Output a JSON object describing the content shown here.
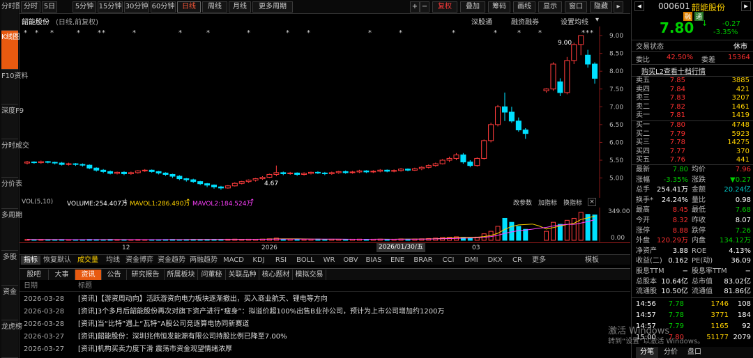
{
  "left_tabs": [
    "分时图",
    "K线图",
    "F10资料",
    "深度F9",
    "分时成交",
    "分价表",
    "多周期",
    "多股",
    "资金",
    "龙虎榜"
  ],
  "toolbar": {
    "left": [
      "分时",
      "5日",
      "5分钟",
      "15分钟",
      "30分钟",
      "60分钟",
      "日线",
      "周线",
      "月线",
      "更多周期"
    ],
    "right": [
      "+",
      "−",
      "复权",
      "叠加",
      "筹码",
      "画线",
      "显示",
      "窗口",
      "隐藏"
    ],
    "active": "日线"
  },
  "chart_header": {
    "stock": "韶能股份",
    "mode": "(日线,前复权)",
    "links": [
      "深股通",
      "融资融券",
      "设置均线"
    ]
  },
  "price_axis": [
    "9.00",
    "8.50",
    "8.00",
    "7.50",
    "7.00",
    "6.50",
    "6.00",
    "5.50",
    "5.00"
  ],
  "annotations": {
    "high": "9.00",
    "low": "4.67"
  },
  "chart_data": {
    "type": "candlestick",
    "ylim": [
      4.6,
      9.1
    ],
    "candles": [
      [
        5.42,
        5.45,
        5.38,
        5.48
      ],
      [
        5.45,
        5.43,
        5.4,
        5.47
      ],
      [
        5.43,
        5.46,
        5.4,
        5.49
      ],
      [
        5.46,
        5.44,
        5.41,
        5.48
      ],
      [
        5.44,
        5.42,
        5.38,
        5.46
      ],
      [
        5.42,
        5.38,
        5.35,
        5.45
      ],
      [
        5.38,
        5.4,
        5.35,
        5.43
      ],
      [
        5.4,
        5.38,
        5.34,
        5.42
      ],
      [
        5.38,
        5.36,
        5.32,
        5.41
      ],
      [
        5.36,
        5.28,
        5.25,
        5.38
      ],
      [
        5.28,
        5.22,
        5.18,
        5.3
      ],
      [
        5.22,
        5.18,
        5.14,
        5.25
      ],
      [
        5.18,
        5.13,
        5.1,
        5.21
      ],
      [
        5.13,
        5.16,
        5.1,
        5.18
      ],
      [
        5.16,
        5.12,
        5.08,
        5.19
      ],
      [
        5.12,
        5.15,
        5.09,
        5.18
      ],
      [
        5.15,
        5.2,
        5.12,
        5.22
      ],
      [
        5.2,
        5.22,
        5.17,
        5.25
      ],
      [
        5.22,
        5.18,
        5.15,
        5.24
      ],
      [
        5.18,
        5.14,
        5.1,
        5.2
      ],
      [
        5.14,
        5.1,
        5.06,
        5.16
      ],
      [
        5.1,
        5.05,
        5.0,
        5.12
      ],
      [
        5.05,
        4.98,
        4.94,
        5.08
      ],
      [
        4.98,
        4.95,
        4.9,
        5.0
      ],
      [
        4.95,
        4.9,
        4.86,
        4.98
      ],
      [
        4.9,
        4.84,
        4.8,
        4.92
      ],
      [
        4.84,
        4.8,
        4.74,
        4.86
      ],
      [
        4.8,
        4.75,
        4.7,
        4.82
      ],
      [
        4.75,
        4.72,
        4.67,
        4.78
      ],
      [
        4.72,
        4.78,
        4.7,
        4.8
      ],
      [
        4.78,
        4.85,
        4.76,
        4.88
      ],
      [
        4.85,
        4.9,
        4.82,
        4.92
      ],
      [
        4.9,
        4.94,
        4.86,
        4.96
      ],
      [
        4.94,
        4.98,
        4.9,
        5.0
      ],
      [
        4.98,
        5.02,
        4.95,
        5.05
      ],
      [
        5.02,
        5.1,
        5.0,
        5.12
      ],
      [
        5.1,
        5.15,
        5.05,
        5.35
      ],
      [
        5.15,
        5.12,
        5.08,
        5.18
      ],
      [
        5.12,
        5.14,
        5.09,
        5.17
      ],
      [
        5.14,
        5.1,
        5.06,
        5.16
      ],
      [
        5.1,
        5.13,
        5.07,
        5.16
      ],
      [
        5.13,
        5.16,
        5.1,
        5.18
      ],
      [
        5.16,
        5.14,
        5.11,
        5.19
      ],
      [
        5.14,
        5.12,
        5.08,
        5.17
      ],
      [
        5.12,
        5.15,
        5.09,
        5.18
      ],
      [
        5.15,
        5.18,
        5.12,
        5.2
      ],
      [
        5.18,
        5.15,
        5.12,
        5.21
      ],
      [
        5.15,
        5.17,
        5.12,
        5.2
      ],
      [
        5.17,
        5.2,
        5.14,
        5.23
      ],
      [
        5.2,
        5.17,
        5.14,
        5.22
      ],
      [
        5.17,
        5.19,
        5.14,
        5.22
      ],
      [
        5.19,
        5.22,
        5.16,
        5.25
      ],
      [
        5.22,
        5.19,
        5.16,
        5.24
      ],
      [
        5.19,
        5.21,
        5.16,
        5.24
      ],
      [
        5.21,
        5.25,
        5.18,
        5.28
      ],
      [
        5.25,
        5.22,
        5.19,
        5.27
      ],
      [
        5.22,
        5.26,
        5.2,
        5.29
      ],
      [
        5.26,
        5.3,
        5.22,
        5.33
      ],
      [
        5.3,
        5.35,
        5.27,
        5.38
      ],
      [
        5.35,
        5.4,
        5.32,
        5.43
      ],
      [
        5.4,
        5.5,
        5.38,
        5.53
      ],
      [
        5.5,
        5.55,
        5.45,
        5.6
      ],
      [
        5.55,
        5.65,
        5.5,
        5.7
      ],
      [
        5.65,
        5.45,
        5.4,
        5.7
      ],
      [
        5.45,
        5.35,
        5.3,
        5.5
      ],
      [
        5.35,
        5.55,
        5.32,
        5.58
      ],
      [
        5.55,
        6.05,
        5.52,
        6.08
      ],
      [
        6.05,
        6.5,
        6.0,
        6.55
      ],
      [
        6.5,
        7.0,
        6.45,
        7.05
      ],
      [
        7.0,
        6.85,
        6.6,
        7.4
      ],
      [
        6.85,
        6.6,
        6.55,
        7.0
      ],
      [
        6.6,
        6.35,
        6.3,
        6.7
      ],
      [
        6.35,
        6.25,
        6.1,
        6.4
      ],
      null,
      null,
      [
        7.45,
        7.5,
        7.4,
        7.52
      ],
      [
        7.5,
        8.2,
        7.45,
        8.25
      ],
      [
        7.7,
        7.4,
        7.3,
        7.8
      ],
      [
        7.4,
        8.3,
        7.35,
        8.4
      ],
      [
        8.3,
        8.75,
        8.2,
        8.8
      ],
      [
        8.75,
        9.0,
        8.45,
        9.0
      ],
      [
        8.45,
        8.2,
        8.1,
        8.6
      ],
      [
        8.2,
        7.8,
        7.65,
        8.25
      ]
    ],
    "volume": [
      0.9,
      0.7,
      0.8,
      0.6,
      0.7,
      0.8,
      0.6,
      0.7,
      0.6,
      0.9,
      0.8,
      0.7,
      0.9,
      0.6,
      0.7,
      0.6,
      0.8,
      0.7,
      0.6,
      0.7,
      0.8,
      0.9,
      0.7,
      0.8,
      0.9,
      0.8,
      0.9,
      1.0,
      0.9,
      1.1,
      1.2,
      1.0,
      1.1,
      1.0,
      1.2,
      1.5,
      2.2,
      1.4,
      1.2,
      1.1,
      1.0,
      1.1,
      1.2,
      1.0,
      1.1,
      1.0,
      1.0,
      1.1,
      1.2,
      1.0,
      1.1,
      1.2,
      1.0,
      1.1,
      1.4,
      1.1,
      1.3,
      1.5,
      1.8,
      2.2,
      2.8,
      3.0,
      3.5,
      3.0,
      2.5,
      3.2,
      6.5,
      9.0,
      14.0,
      22.0,
      18.0,
      14.0,
      11.0,
      null,
      null,
      9.0,
      18.0,
      16.0,
      20.0,
      22.0,
      28.0,
      26.0,
      25.4
    ],
    "volume_axis": [
      "349.00",
      "0.00"
    ],
    "x_labels": [
      "12",
      "2026",
      "03"
    ]
  },
  "vol_header": {
    "vol": "VOL(5,10)",
    "volume": "VOLUME:254.407万",
    "mavol1": "MAVOL1:286.490万",
    "mavol2": "MAVOL2:184.524万",
    "links": [
      "改参数",
      "加指标",
      "换指标"
    ]
  },
  "date_tag": "2026/01/30/五",
  "indicators": [
    "指标",
    "恢复默认",
    "成交量",
    "均线",
    "资金博弈",
    "资金趋势",
    "两融趋势",
    "MACD",
    "KDJ",
    "RSI",
    "BOLL",
    "WR",
    "OBV",
    "BIAS",
    "ENE",
    "BRAR",
    "CCI",
    "DMI",
    "DKX",
    "CR",
    "更多",
    "模板"
  ],
  "news_tabs": [
    "股吧",
    "大事",
    "资讯",
    "公告",
    "研究报告",
    "所属板块",
    "问董秘",
    "关联品种",
    "核心题材",
    "模拟交易"
  ],
  "news_header": {
    "date": "日期",
    "title": "标题"
  },
  "news": [
    {
      "date": "2026-03-28",
      "title": "[资讯]【游资周动向】活跃游资向电力板块逐渐撤出，买入商业航天、锂电等方向"
    },
    {
      "date": "2026-03-28",
      "title": "[资讯]3个多月后韶能股份再次对旗下资产进行“瘦身”：拟溢价超100%出售B业孙公司，预计为上市公司增加约1200万"
    },
    {
      "date": "2026-03-28",
      "title": "[资讯]当“比特”遇上“瓦特”A股公司竞逐算电协同新赛道"
    },
    {
      "date": "2026-03-27",
      "title": "[资讯]韶能股份：深圳兆伟恒发能源有限公司持股比例已降至7.00%"
    },
    {
      "date": "2026-03-27",
      "title": "[资讯]机构买卖力度下滑 震荡市资金观望情绪浓厚"
    }
  ],
  "right": {
    "code": "000601",
    "name": "韶能股份",
    "tags": [
      "融",
      "通"
    ],
    "price": "7.80",
    "change": "-0.27",
    "change_pct": "-3.35%",
    "status_label": "交易状态",
    "status": "休市",
    "weibi_label": "委比",
    "weibi": "42.50%",
    "weicha_label": "委差",
    "weicha": "15364",
    "l2": "购买L2查看十档行情",
    "sells": [
      {
        "l": "卖五",
        "p": "7.85",
        "v": "3885"
      },
      {
        "l": "卖四",
        "p": "7.84",
        "v": "421"
      },
      {
        "l": "卖三",
        "p": "7.83",
        "v": "3207"
      },
      {
        "l": "卖二",
        "p": "7.82",
        "v": "1461"
      },
      {
        "l": "卖一",
        "p": "7.81",
        "v": "1419"
      }
    ],
    "buys": [
      {
        "l": "买一",
        "p": "7.80",
        "v": "4748"
      },
      {
        "l": "买二",
        "p": "7.79",
        "v": "5923"
      },
      {
        "l": "买三",
        "p": "7.78",
        "v": "14275"
      },
      {
        "l": "买四",
        "p": "7.77",
        "v": "370"
      },
      {
        "l": "买五",
        "p": "7.76",
        "v": "441"
      }
    ],
    "stats": [
      {
        "a": "最新",
        "av": "7.80",
        "ac": "grn",
        "b": "均价",
        "bv": "7.96",
        "bc": "red"
      },
      {
        "a": "涨幅",
        "av": "-3.35%",
        "ac": "grn",
        "b": "涨跌",
        "bv": "▼0.27",
        "bc": "grn"
      },
      {
        "a": "总手",
        "av": "254.41万",
        "ac": "wht",
        "b": "金额",
        "bv": "20.24亿",
        "bc": "cy"
      },
      {
        "a": "换手*",
        "av": "24.24%",
        "ac": "wht",
        "b": "量比",
        "bv": "0.98",
        "bc": "wht"
      },
      {
        "a": "最高",
        "av": "8.45",
        "ac": "red",
        "b": "最低",
        "bv": "7.68",
        "bc": "grn"
      },
      {
        "a": "今开",
        "av": "8.32",
        "ac": "red",
        "b": "昨收",
        "bv": "8.07",
        "bc": "wht"
      },
      {
        "a": "涨停",
        "av": "8.88",
        "ac": "red",
        "b": "跌停",
        "bv": "7.26",
        "bc": "grn"
      },
      {
        "a": "外盘",
        "av": "120.29万",
        "ac": "red",
        "b": "内盘",
        "bv": "134.12万",
        "bc": "grn"
      },
      {
        "a": "净资产",
        "av": "3.88",
        "ac": "wht",
        "b": "ROE",
        "bv": "4.13%",
        "bc": "wht"
      },
      {
        "a": "收益(二)",
        "av": "0.162",
        "ac": "wht",
        "b": "PE(动)",
        "bv": "36.09",
        "bc": "wht"
      },
      {
        "a": "股息TTM",
        "av": "−",
        "ac": "wht",
        "b": "股息率TTM",
        "bv": "−",
        "bc": "wht"
      },
      {
        "a": "总股本",
        "av": "10.64亿",
        "ac": "wht",
        "b": "总市值",
        "bv": "83.02亿",
        "bc": "wht"
      },
      {
        "a": "流通股",
        "av": "10.50亿",
        "ac": "wht",
        "b": "流通值",
        "bv": "81.86亿",
        "bc": "wht"
      }
    ],
    "ticks": [
      {
        "t": "14:56",
        "p": "7.78",
        "v": "1746",
        "n": "108"
      },
      {
        "t": "14:57",
        "p": "7.78",
        "v": "3771",
        "n": "184"
      },
      {
        "t": "14:57",
        "p": "7.79",
        "v": "1165",
        "n": "92"
      },
      {
        "t": "15:00",
        "p": "7.80",
        "v": "51177",
        "n": "2079"
      }
    ],
    "bottom_tabs": [
      "分笔",
      "分价",
      "盘口"
    ]
  },
  "watermark": {
    "line1": "激活 Windows",
    "line2": "转到“设置”以激活 Windows。"
  }
}
